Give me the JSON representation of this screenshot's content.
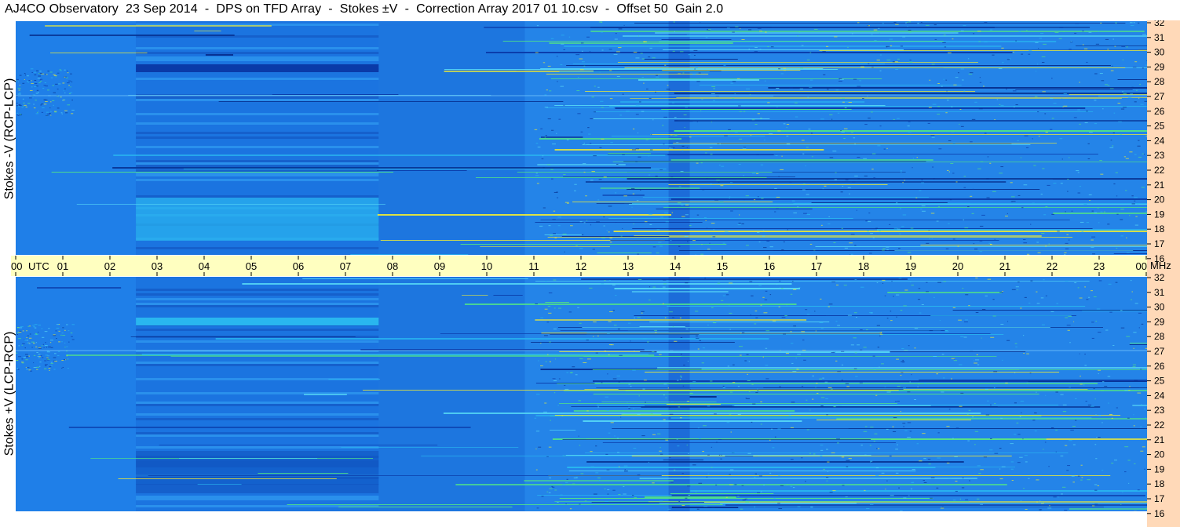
{
  "title": "AJ4CO Observatory  23 Sep 2014  -  DPS on TFD Array  -  Stokes ±V  -  Correction Array 2017 01 10.csv  -  Offset 50  Gain 2.0",
  "chart_data": {
    "type": "heatmap",
    "subplots": [
      {
        "ylabel": "Stokes -V (RCP-LCP)"
      },
      {
        "ylabel": "Stokes +V (LCP-RCP)"
      }
    ],
    "x_ticks": [
      "00",
      "UTC",
      "01",
      "02",
      "03",
      "04",
      "05",
      "06",
      "07",
      "08",
      "09",
      "10",
      "11",
      "12",
      "13",
      "14",
      "15",
      "16",
      "17",
      "18",
      "19",
      "20",
      "21",
      "22",
      "23",
      "00",
      "MHz"
    ],
    "x_range_utc_hours": [
      0,
      24
    ],
    "y_ticks": [
      "32",
      "31",
      "30",
      "29",
      "28",
      "27",
      "26",
      "25",
      "24",
      "23",
      "22",
      "21",
      "20",
      "19",
      "18",
      "17",
      "16"
    ],
    "y_range_mhz": [
      16,
      32
    ],
    "colors": {
      "background_field": "#1f7fe8",
      "dark_band": "#0a3aa8",
      "light_band": "#29b6ef",
      "hot": "#e8e83a",
      "time_axis_bg": "#ffffc0",
      "freq_axis_bg": "#ffd9b8"
    }
  }
}
